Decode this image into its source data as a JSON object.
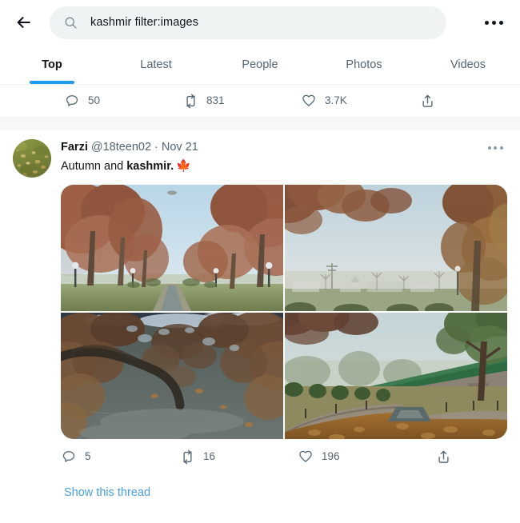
{
  "app": {
    "name": "Twitter Search Results",
    "accent_color": "#1d9bf0",
    "link_color": "#4a9fe0",
    "text_color": "#0f1419",
    "muted_color": "#536471",
    "search_bg": "#eff3f4",
    "separator_bg": "#f7f9f9"
  },
  "header": {
    "back_icon": "back-arrow-icon",
    "more_icon": "more-horizontal-icon",
    "search": {
      "icon": "search-icon",
      "value": "kashmir filter:images",
      "placeholder": "Search Twitter"
    }
  },
  "tabs": [
    {
      "label": "Top",
      "active": true
    },
    {
      "label": "Latest",
      "active": false
    },
    {
      "label": "People",
      "active": false
    },
    {
      "label": "Photos",
      "active": false
    },
    {
      "label": "Videos",
      "active": false
    }
  ],
  "top_tweet_actions": {
    "reply": {
      "icon": "reply-icon",
      "count": "50"
    },
    "retweet": {
      "icon": "retweet-icon",
      "count": "831"
    },
    "like": {
      "icon": "heart-icon",
      "count": "3.7K"
    },
    "share": {
      "icon": "share-icon",
      "count": ""
    }
  },
  "tweet": {
    "avatar": {
      "name": "user-avatar",
      "description": "grass with scattered autumn leaves"
    },
    "author_name": "Farzi",
    "author_handle": "@18teen02",
    "separator": "·",
    "date": "Nov 21",
    "more_icon": "more-horizontal-icon",
    "text_before": "Autumn and ",
    "text_highlight": "kashmir",
    "text_after": ".",
    "emoji": "🍁",
    "photos": [
      {
        "name": "photo-autumn-avenue",
        "alt": "Tree lined park avenue with rust colored autumn chinar trees and blue sky"
      },
      {
        "name": "photo-hazy-park",
        "alt": "Hazy park framed by autumn foliage with distant buildings"
      },
      {
        "name": "photo-water-reflection",
        "alt": "Inverted reflection of autumn trees on dark still water with sun glare"
      },
      {
        "name": "photo-garden-channel",
        "alt": "Garden with stone walls, leaf covered channel, green fence and hedges"
      }
    ],
    "actions": {
      "reply": {
        "icon": "reply-icon",
        "count": "5"
      },
      "retweet": {
        "icon": "retweet-icon",
        "count": "16"
      },
      "like": {
        "icon": "heart-icon",
        "count": "196"
      },
      "share": {
        "icon": "share-icon",
        "count": ""
      }
    },
    "show_thread_label": "Show this thread"
  }
}
